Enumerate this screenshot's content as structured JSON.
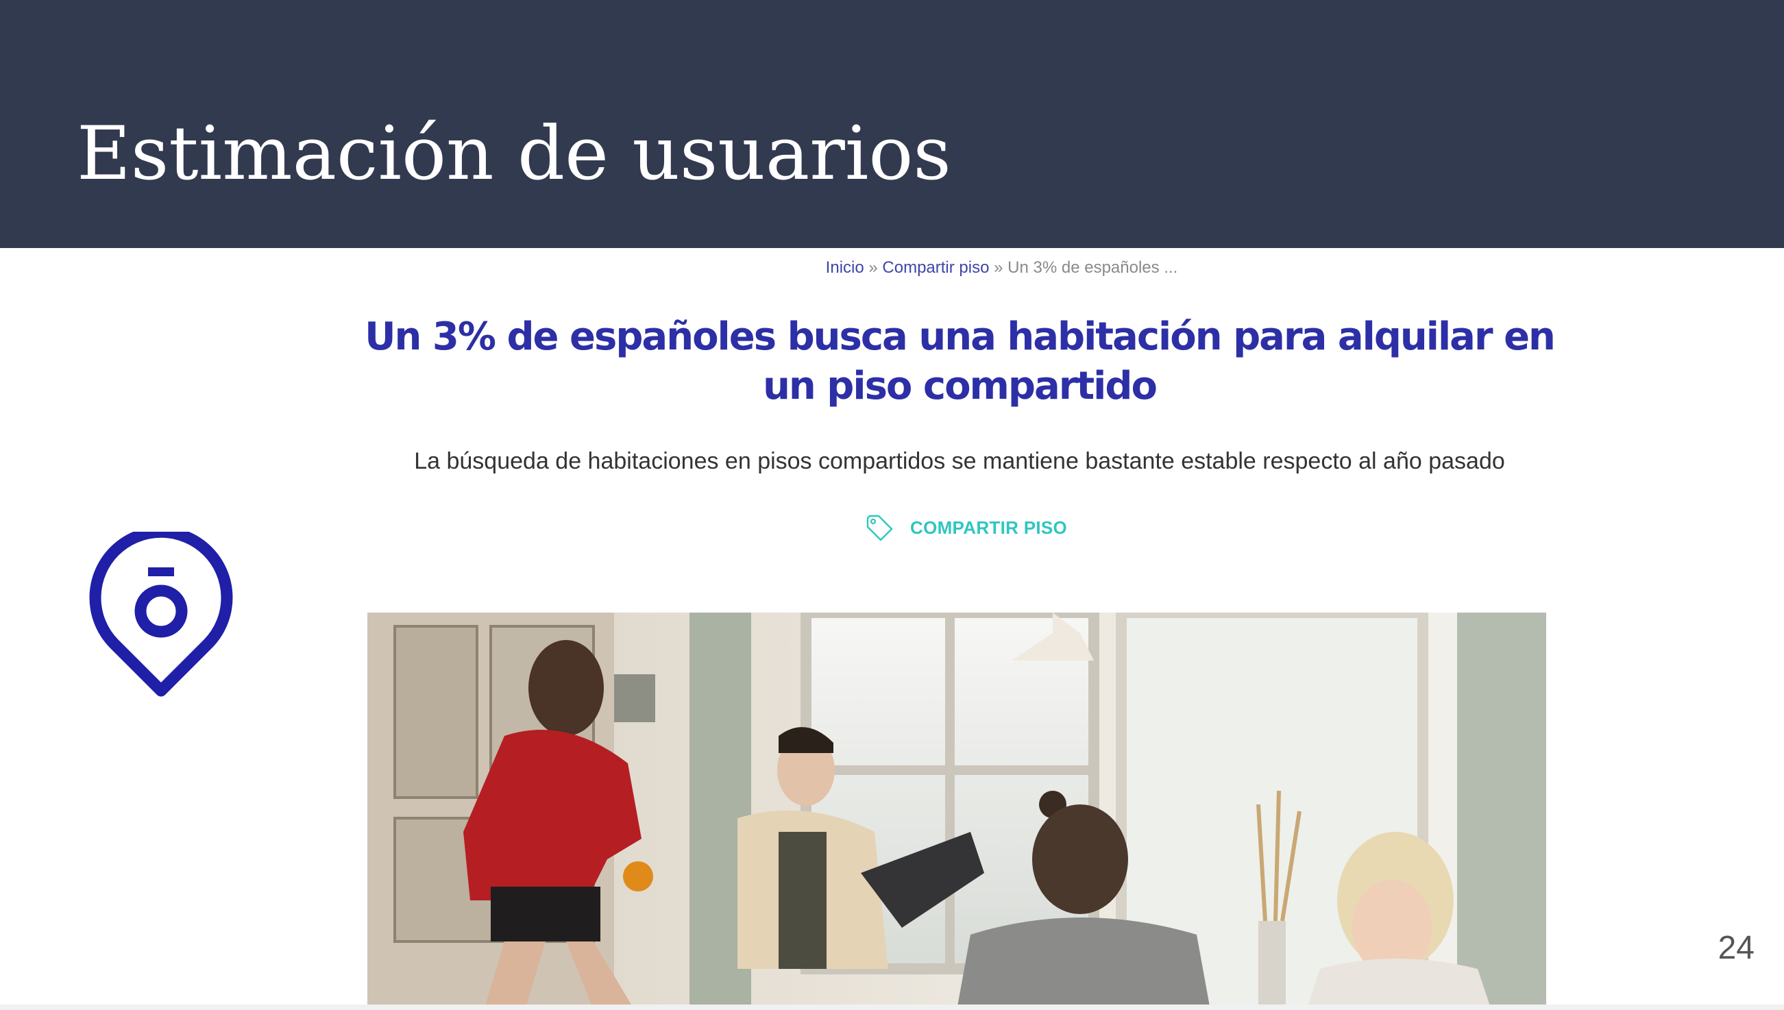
{
  "slide": {
    "title": "Estimación de usuarios",
    "page_number": "24"
  },
  "article": {
    "breadcrumb": {
      "home": "Inicio",
      "separator": "»",
      "section": "Compartir piso",
      "current": "Un 3% de españoles ..."
    },
    "title": "Un 3% de españoles busca una habitación para alquilar en un piso compartido",
    "subtitle": "La búsqueda de habitaciones en pisos compartidos se mantiene bastante estable respecto al año pasado",
    "tag": {
      "icon": "tag-icon",
      "label": "COMPARTIR PISO"
    },
    "image": {
      "alt": "Cuatro jóvenes conversando en la cocina de un piso compartido"
    }
  },
  "logo": {
    "icon": "map-pin-logo-icon"
  },
  "colors": {
    "header_bg": "#323a4f",
    "title_text": "#ffffff",
    "article_title": "#2d2fa6",
    "tag_accent": "#2fc6c0",
    "logo": "#1f1fa8"
  }
}
